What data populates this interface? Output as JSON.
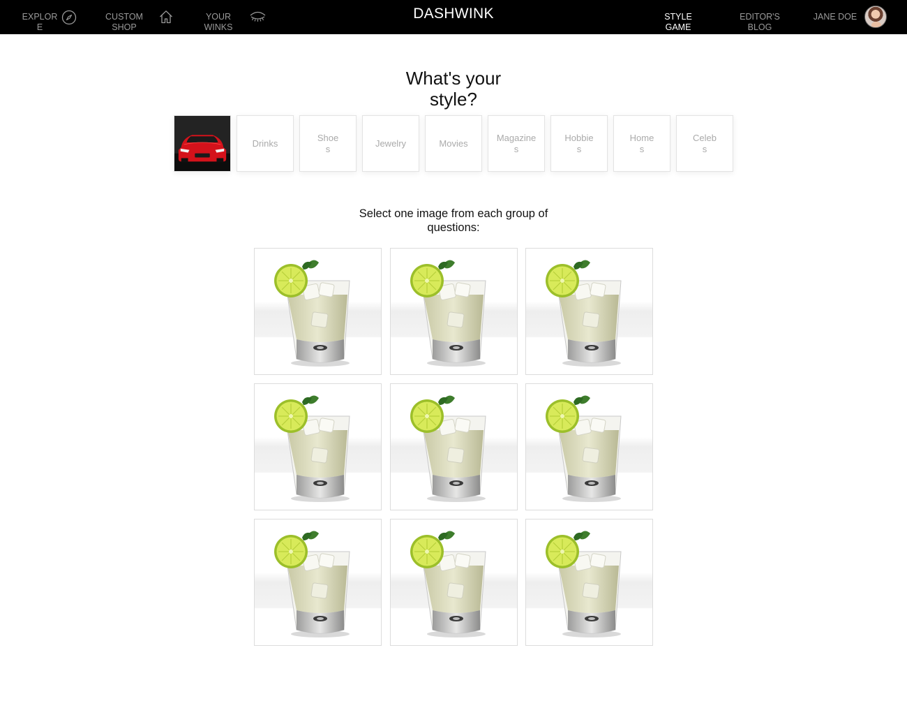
{
  "nav": {
    "explore_label": "EXPLOR E",
    "custom_shop_label": "CUSTOM SHOP",
    "your_winks_label": "YOUR WINKS",
    "brand": "DASHWINK",
    "style_game_label": "STYLE GAME",
    "editors_blog_label": "EDITOR'S BLOG",
    "user_name": "JANE DOE",
    "icons": [
      "compass-icon",
      "home-icon",
      "eye-icon"
    ]
  },
  "page_title": "What's your style?",
  "categories": [
    {
      "label": "",
      "image": "red-sports-car",
      "selected": true
    },
    {
      "label": "Drinks"
    },
    {
      "label": "Shoe s"
    },
    {
      "label": "Jewelry"
    },
    {
      "label": "Movies"
    },
    {
      "label": "Magazine s"
    },
    {
      "label": "Hobbie s"
    },
    {
      "label": "Home s"
    },
    {
      "label": "Celeb s"
    }
  ],
  "instruction": "Select one image from each group of questions:",
  "choices": [
    {
      "image": "gin-tonic-with-lime"
    },
    {
      "image": "gin-tonic-with-lime"
    },
    {
      "image": "gin-tonic-with-lime"
    },
    {
      "image": "gin-tonic-with-lime"
    },
    {
      "image": "gin-tonic-with-lime"
    },
    {
      "image": "gin-tonic-with-lime"
    },
    {
      "image": "gin-tonic-with-lime"
    },
    {
      "image": "gin-tonic-with-lime"
    },
    {
      "image": "gin-tonic-with-lime"
    }
  ],
  "colors": {
    "nav_bg": "#000000",
    "nav_text": "#9a9a9a",
    "nav_active": "#ffffff",
    "car_red": "#d4121b",
    "lime": "#c7dc3a"
  }
}
